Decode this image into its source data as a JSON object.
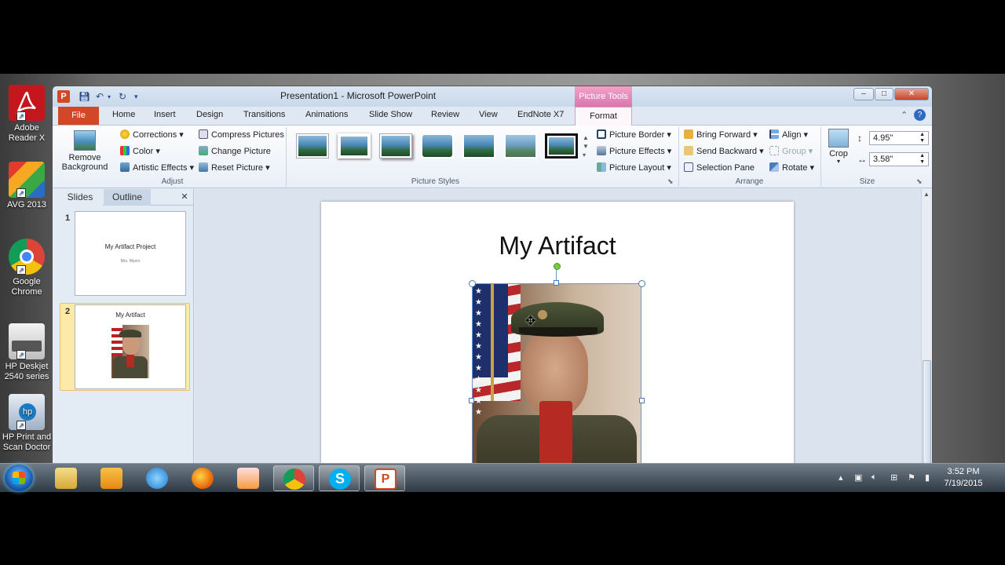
{
  "desktop": {
    "icons": [
      {
        "label": "Adobe Reader X",
        "name": "adobe-reader-icon"
      },
      {
        "label": "AVG 2013",
        "name": "avg-icon"
      },
      {
        "label": "Google Chrome",
        "name": "chrome-icon"
      },
      {
        "label": "HP Deskjet 2540 series",
        "name": "hp-printer-icon"
      },
      {
        "label": "HP Print and Scan Doctor",
        "name": "hp-doctor-icon"
      }
    ]
  },
  "window": {
    "title": "Presentation1  -  Microsoft PowerPoint",
    "contextual_tab_group": "Picture Tools",
    "controls": {
      "minimize": "‒",
      "maximize": "□",
      "close": "✕"
    }
  },
  "tabs": {
    "file": "File",
    "home": "Home",
    "insert": "Insert",
    "design": "Design",
    "transitions": "Transitions",
    "animations": "Animations",
    "slide_show": "Slide Show",
    "review": "Review",
    "view": "View",
    "endnote": "EndNote X7",
    "format": "Format"
  },
  "ribbon": {
    "adjust": {
      "remove_background": "Remove Background",
      "corrections": "Corrections",
      "color": "Color",
      "artistic_effects": "Artistic Effects",
      "compress_pictures": "Compress Pictures",
      "change_picture": "Change Picture",
      "reset_picture": "Reset Picture",
      "label": "Adjust"
    },
    "picture_styles": {
      "label": "Picture Styles",
      "picture_border": "Picture Border",
      "picture_effects": "Picture Effects",
      "picture_layout": "Picture Layout"
    },
    "arrange": {
      "bring_forward": "Bring Forward",
      "send_backward": "Send Backward",
      "selection_pane": "Selection Pane",
      "align": "Align",
      "group": "Group",
      "rotate": "Rotate",
      "label": "Arrange"
    },
    "size": {
      "crop": "Crop",
      "height": "4.95\"",
      "width": "3.58\"",
      "label": "Size"
    }
  },
  "slides_pane": {
    "tab_slides": "Slides",
    "tab_outline": "Outline",
    "close": "✕",
    "slides": [
      {
        "number": "1",
        "title": "My Artifact Project",
        "subtitle": "Mrs. Myers"
      },
      {
        "number": "2",
        "title": "My Artifact"
      }
    ]
  },
  "slide": {
    "title": "My Artifact"
  },
  "taskbar": {
    "time": "3:52 PM",
    "date": "7/19/2015"
  }
}
